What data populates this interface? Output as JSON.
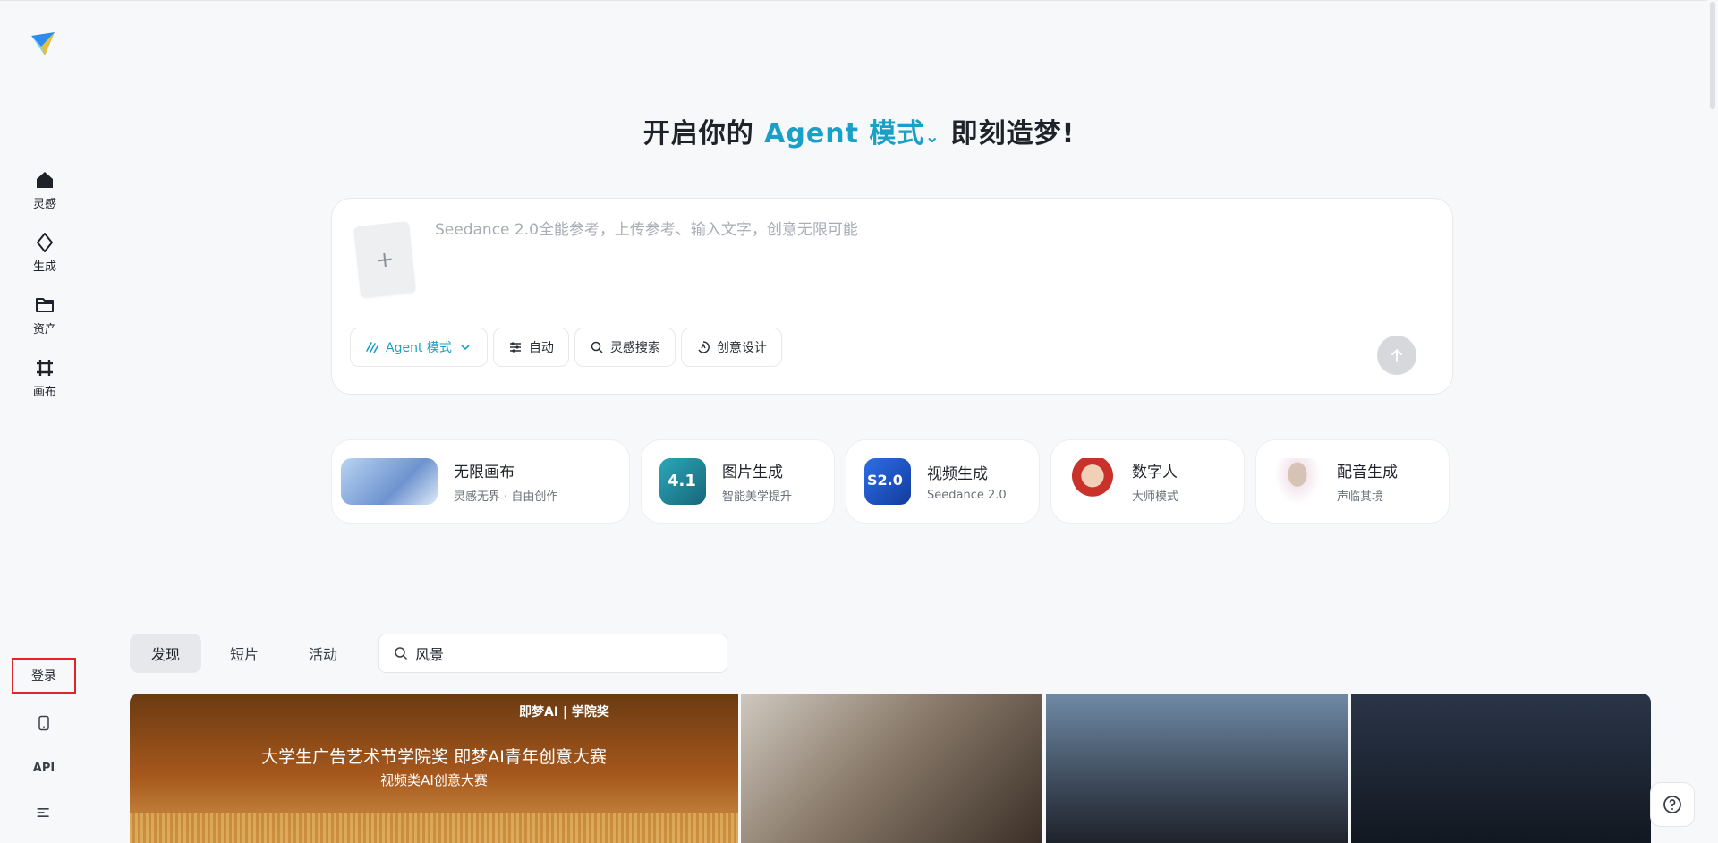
{
  "colors": {
    "accent": "#1aa0c6",
    "highlight_border": "#e0252a"
  },
  "sidebar": {
    "logo_icon": "paper-plane-logo",
    "items": [
      {
        "label": "灵感",
        "icon": "home-icon"
      },
      {
        "label": "生成",
        "icon": "sparkle-diamond-icon"
      },
      {
        "label": "资产",
        "icon": "folder-icon"
      },
      {
        "label": "画布",
        "icon": "canvas-hash-icon"
      }
    ],
    "login_label": "登录",
    "mobile_icon": "mobile-icon",
    "api_label": "API",
    "menu_icon": "menu-icon"
  },
  "headline": {
    "prefix": "开启你的",
    "mode": "Agent 模式",
    "suffix": "即刻造梦!"
  },
  "prompt": {
    "placeholder": "Seedance 2.0全能参考，上传参考、输入文字，创意无限可能",
    "upload_symbol": "+",
    "chips": [
      {
        "label": "Agent 模式",
        "icon": "agent-wave-icon"
      },
      {
        "label": "自动",
        "icon": "sliders-icon"
      },
      {
        "label": "灵感搜索",
        "icon": "search-refresh-icon"
      },
      {
        "label": "创意设计",
        "icon": "creative-design-icon"
      }
    ],
    "send_icon": "arrow-up-icon"
  },
  "features": [
    {
      "title": "无限画布",
      "subtitle": "灵感无界 · 自由创作"
    },
    {
      "title": "图片生成",
      "subtitle": "智能美学提升",
      "badge": "4.1"
    },
    {
      "title": "视频生成",
      "subtitle": "Seedance 2.0",
      "badge": "S2.0"
    },
    {
      "title": "数字人",
      "subtitle": "大师模式"
    },
    {
      "title": "配音生成",
      "subtitle": "声临其境"
    }
  ],
  "tabs": [
    {
      "label": "发现",
      "active": true
    },
    {
      "label": "短片",
      "active": false
    },
    {
      "label": "活动",
      "active": false
    }
  ],
  "search": {
    "value": "风景"
  },
  "gallery": {
    "banner_brand": "即梦AI | 学院奖",
    "banner_title": "大学生广告艺术节学院奖 即梦AI青年创意大赛",
    "banner_subtitle": "视频类AI创意大赛"
  },
  "help_icon": "question-icon"
}
